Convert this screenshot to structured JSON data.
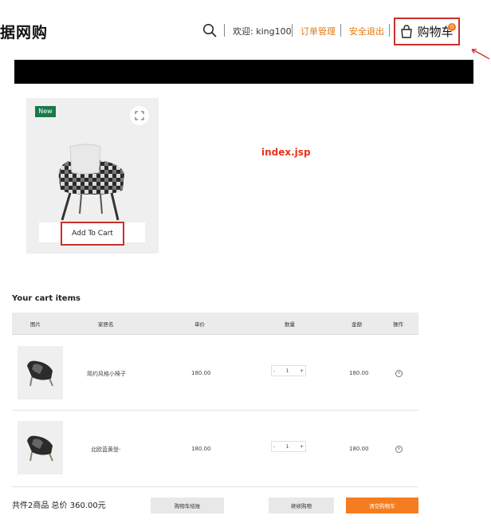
{
  "header": {
    "logo_text": "据网购",
    "welcome": "欢迎: king100",
    "orders_link": "订单管理",
    "logout_link": "安全退出",
    "cart_label": "购物车",
    "cart_badge": "0"
  },
  "product": {
    "badge": "New",
    "add_to_cart": "Add To Cart"
  },
  "annotation": {
    "index_label": "index.jsp"
  },
  "cart": {
    "title": "Your cart items",
    "columns": [
      "图片",
      "家居名",
      "单价",
      "数量",
      "金额",
      "操作"
    ],
    "rows": [
      {
        "name": "简约风格小椅子",
        "price": "180.00",
        "qty": "1",
        "amount": "180.00"
      },
      {
        "name": "北欧蓝黄登-",
        "price": "180.00",
        "qty": "1",
        "amount": "180.00"
      }
    ],
    "qty_minus": "-",
    "qty_plus": "+",
    "summary": "共件2商品 总价 360.00元",
    "btn_clear": "购物车结账",
    "btn_continue": "继续购物",
    "btn_checkout": "清空购物车"
  },
  "colors": {
    "accent": "#f57d1f",
    "link": "#e07a12",
    "highlight_border": "#c9302c",
    "new_badge": "#1a7a4a",
    "annotation": "#e8321f"
  },
  "icons": {
    "search": "search-icon",
    "bag": "bag-icon",
    "expand": "expand-icon",
    "remove": "remove-icon"
  }
}
